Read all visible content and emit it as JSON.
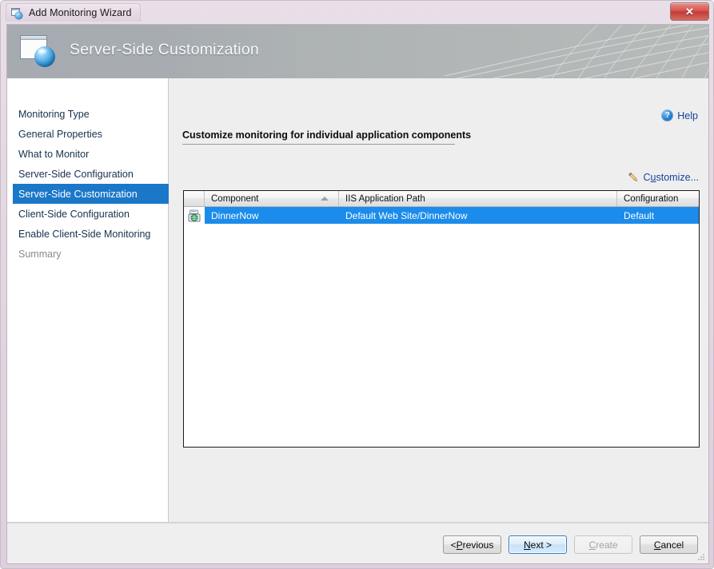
{
  "window": {
    "title": "Add Monitoring Wizard",
    "app_icon": "window-sphere-icon",
    "close_label": "✕"
  },
  "banner": {
    "title": "Server-Side Customization",
    "icon": "window-sphere-icon"
  },
  "sidebar": {
    "items": [
      {
        "label": "Monitoring Type",
        "state": "normal"
      },
      {
        "label": "General Properties",
        "state": "normal"
      },
      {
        "label": "What to Monitor",
        "state": "normal"
      },
      {
        "label": "Server-Side Configuration",
        "state": "normal"
      },
      {
        "label": "Server-Side Customization",
        "state": "selected"
      },
      {
        "label": "Client-Side Configuration",
        "state": "normal"
      },
      {
        "label": "Enable Client-Side Monitoring",
        "state": "normal"
      },
      {
        "label": "Summary",
        "state": "disabled"
      }
    ]
  },
  "content": {
    "help": {
      "label": "Help",
      "icon": "help-circle-icon"
    },
    "section_title": "Customize monitoring for individual application components",
    "customize": {
      "label_before": "C",
      "label_mnemonic": "u",
      "label_after": "stomize...",
      "icon": "pencil-icon"
    },
    "grid": {
      "columns": [
        {
          "key": "icon",
          "label": ""
        },
        {
          "key": "component",
          "label": "Component",
          "sorted": "asc"
        },
        {
          "key": "path",
          "label": "IIS Application Path"
        },
        {
          "key": "configuration",
          "label": "Configuration"
        }
      ],
      "rows": [
        {
          "icon": "web-application-icon",
          "component": "DinnerNow",
          "path": "Default Web Site/DinnerNow",
          "configuration": "Default",
          "selected": true
        }
      ]
    }
  },
  "footer": {
    "buttons": [
      {
        "name": "previous",
        "prefix": "< ",
        "mnemonic": "P",
        "suffix": "revious",
        "style": "normal"
      },
      {
        "name": "next",
        "prefix": "",
        "mnemonic": "N",
        "suffix": "ext >",
        "style": "default"
      },
      {
        "name": "create",
        "prefix": "",
        "mnemonic": "C",
        "suffix": "reate",
        "style": "disabled"
      },
      {
        "name": "cancel",
        "prefix": "",
        "mnemonic": "C",
        "suffix": "ancel",
        "style": "normal"
      }
    ]
  },
  "colors": {
    "accent_selection": "#1b8ceb",
    "nav_selected": "#1b77c8",
    "link": "#14449c",
    "banner_left": "#a6abb2",
    "banner_right": "#b6bab9",
    "close_button": "#c23b35"
  }
}
